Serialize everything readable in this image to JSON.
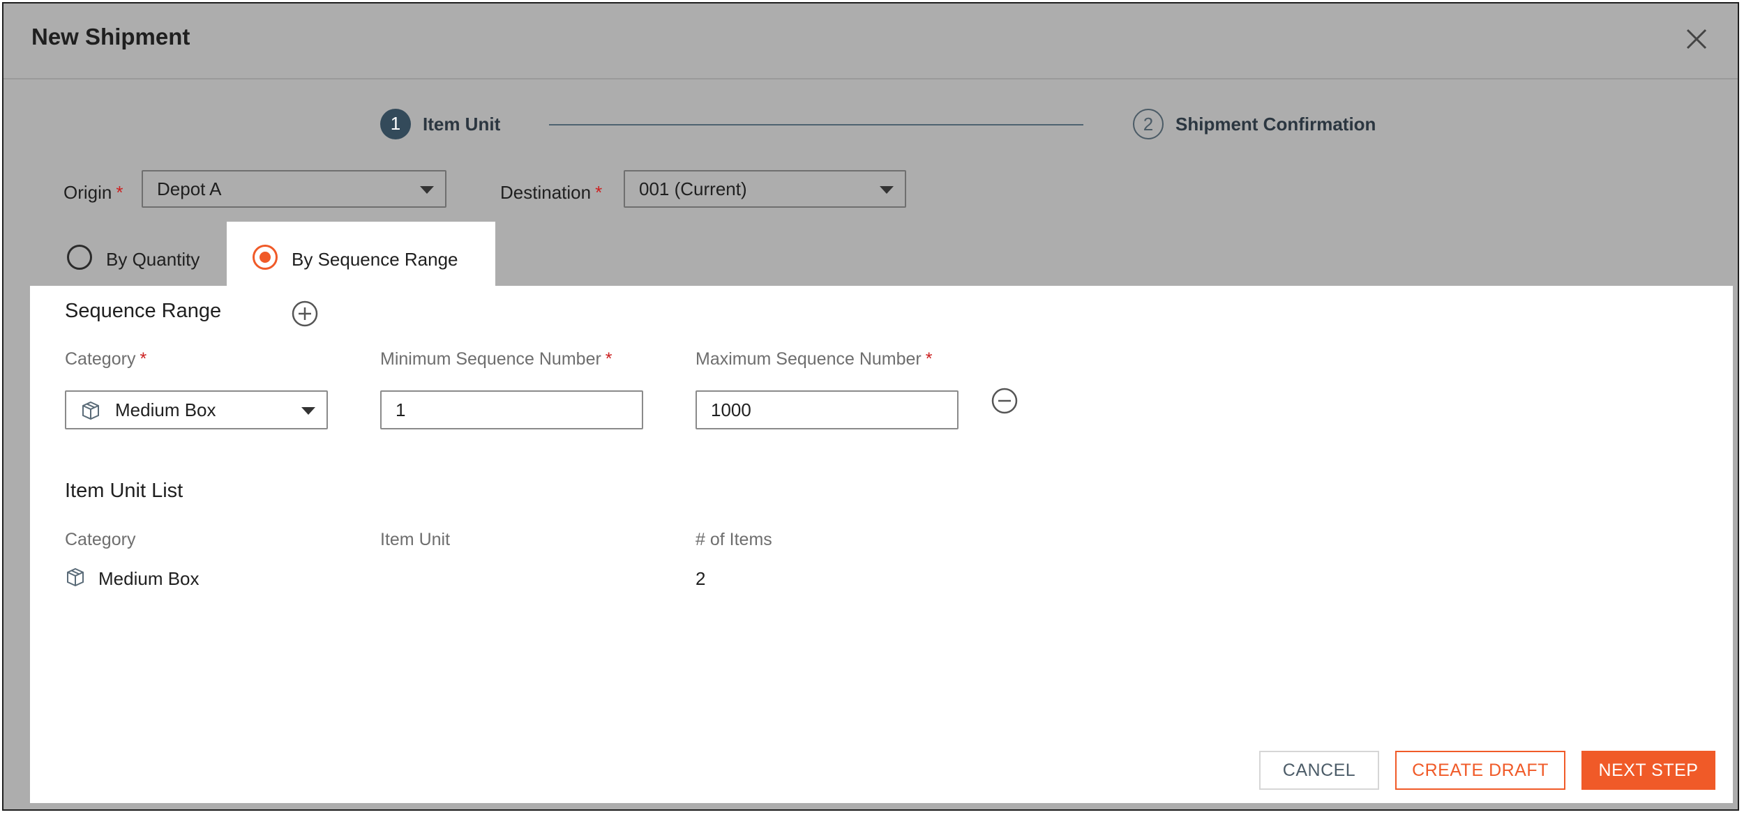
{
  "dialog": {
    "title": "New Shipment",
    "close_icon": "close-icon"
  },
  "stepper": {
    "steps": [
      {
        "number": "1",
        "label": "Item Unit",
        "state": "active"
      },
      {
        "number": "2",
        "label": "Shipment Confirmation",
        "state": "inactive"
      }
    ]
  },
  "origin": {
    "label": "Origin",
    "required_mark": "*",
    "value": "Depot A"
  },
  "destination": {
    "label": "Destination",
    "required_mark": "*",
    "value": "001 (Current)"
  },
  "mode_tabs": [
    {
      "label": "By Quantity",
      "selected": false
    },
    {
      "label": "By Sequence Range",
      "selected": true
    }
  ],
  "sequence_range": {
    "title": "Sequence Range",
    "add_icon": "plus-circle-icon",
    "category_label": "Category",
    "min_label": "Minimum Sequence Number",
    "max_label": "Maximum Sequence Number",
    "required_mark": "*",
    "row": {
      "category": "Medium Box",
      "category_icon": "box-icon",
      "min": "1",
      "max": "1000",
      "remove_icon": "minus-circle-icon"
    }
  },
  "item_unit_list": {
    "title": "Item Unit List",
    "columns": [
      "Category",
      "Item Unit",
      "# of Items"
    ],
    "rows": [
      {
        "category": "Medium Box",
        "item_unit": "",
        "count": "2"
      }
    ]
  },
  "footer": {
    "cancel_label": "CANCEL",
    "create_draft_label": "CREATE DRAFT",
    "next_step_label": "NEXT STEP"
  },
  "colors": {
    "accent": "#f05a28",
    "step_active": "#334a5a",
    "overlay": "#adadad"
  }
}
